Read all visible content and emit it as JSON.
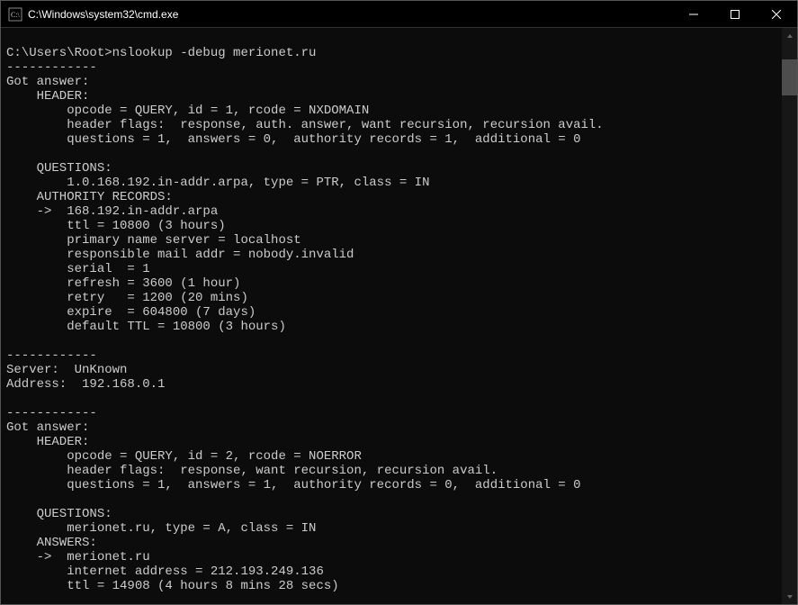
{
  "window": {
    "title": "C:\\Windows\\system32\\cmd.exe"
  },
  "terminal": {
    "lines": [
      "",
      "C:\\Users\\Root>nslookup -debug merionet.ru",
      "------------",
      "Got answer:",
      "    HEADER:",
      "        opcode = QUERY, id = 1, rcode = NXDOMAIN",
      "        header flags:  response, auth. answer, want recursion, recursion avail.",
      "        questions = 1,  answers = 0,  authority records = 1,  additional = 0",
      "",
      "    QUESTIONS:",
      "        1.0.168.192.in-addr.arpa, type = PTR, class = IN",
      "    AUTHORITY RECORDS:",
      "    ->  168.192.in-addr.arpa",
      "        ttl = 10800 (3 hours)",
      "        primary name server = localhost",
      "        responsible mail addr = nobody.invalid",
      "        serial  = 1",
      "        refresh = 3600 (1 hour)",
      "        retry   = 1200 (20 mins)",
      "        expire  = 604800 (7 days)",
      "        default TTL = 10800 (3 hours)",
      "",
      "------------",
      "Server:  UnKnown",
      "Address:  192.168.0.1",
      "",
      "------------",
      "Got answer:",
      "    HEADER:",
      "        opcode = QUERY, id = 2, rcode = NOERROR",
      "        header flags:  response, want recursion, recursion avail.",
      "        questions = 1,  answers = 1,  authority records = 0,  additional = 0",
      "",
      "    QUESTIONS:",
      "        merionet.ru, type = A, class = IN",
      "    ANSWERS:",
      "    ->  merionet.ru",
      "        internet address = 212.193.249.136",
      "        ttl = 14908 (4 hours 8 mins 28 secs)"
    ]
  }
}
